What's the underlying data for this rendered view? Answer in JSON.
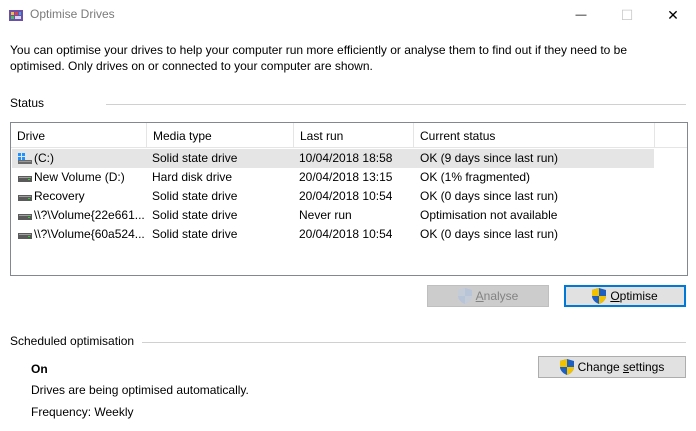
{
  "window": {
    "title": "Optimise Drives",
    "minimize_glyph": "—",
    "maximize_glyph": "☐",
    "close_glyph": "✕"
  },
  "intro_text": "You can optimise your drives to help your computer run more efficiently or analyse them to find out if they need to be optimised. Only drives on or connected to your computer are shown.",
  "status": {
    "group_label": "Status",
    "columns": [
      "Drive",
      "Media type",
      "Last run",
      "Current status"
    ],
    "rows": [
      {
        "drive": "(C:)",
        "media_type": "Solid state drive",
        "last_run": "10/04/2018 18:58",
        "current_status": "OK (9 days since last run)",
        "icon": "system-drive-icon",
        "selected": true
      },
      {
        "drive": "New Volume (D:)",
        "media_type": "Hard disk drive",
        "last_run": "20/04/2018 13:15",
        "current_status": "OK (1% fragmented)",
        "icon": "drive-icon",
        "selected": false
      },
      {
        "drive": "Recovery",
        "media_type": "Solid state drive",
        "last_run": "20/04/2018 10:54",
        "current_status": "OK (0 days since last run)",
        "icon": "drive-icon",
        "selected": false
      },
      {
        "drive": "\\\\?\\Volume{22e661...",
        "media_type": "Solid state drive",
        "last_run": "Never run",
        "current_status": "Optimisation not available",
        "icon": "drive-icon",
        "selected": false
      },
      {
        "drive": "\\\\?\\Volume{60a524...",
        "media_type": "Solid state drive",
        "last_run": "20/04/2018 10:54",
        "current_status": "OK (0 days since last run)",
        "icon": "drive-icon",
        "selected": false
      }
    ]
  },
  "buttons": {
    "analyse": {
      "label_accel": "A",
      "label_rest": "nalyse",
      "enabled": false
    },
    "optimise": {
      "label_accel": "O",
      "label_rest": "ptimise",
      "enabled": true
    },
    "change_settings": {
      "label_pre": "Change ",
      "label_accel": "s",
      "label_rest": "ettings",
      "enabled": true
    }
  },
  "scheduled": {
    "group_label": "Scheduled optimisation",
    "state": "On",
    "description": "Drives are being optimised automatically.",
    "frequency": "Frequency: Weekly"
  },
  "colors": {
    "accent": "#0078d7",
    "selected_row": "#e5e5e5",
    "shield_blue": "#1f5fbf",
    "shield_yellow": "#f2c200"
  }
}
